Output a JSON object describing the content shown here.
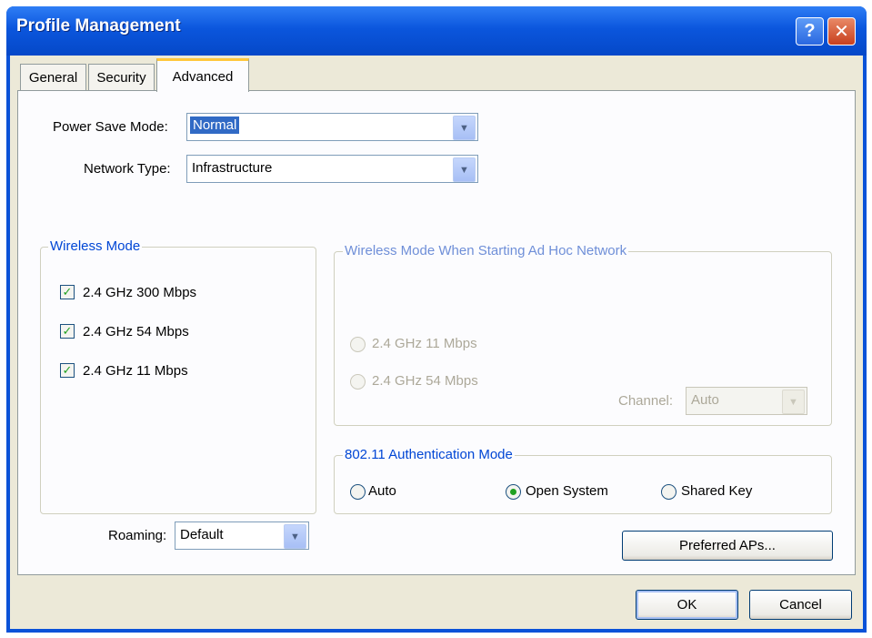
{
  "window": {
    "title": "Profile Management",
    "help_label": "?",
    "close_label": "✕"
  },
  "tabs": [
    {
      "label": "General",
      "active": false
    },
    {
      "label": "Security",
      "active": false
    },
    {
      "label": "Advanced",
      "active": true
    }
  ],
  "power_save": {
    "label": "Power Save Mode:",
    "value": "Normal"
  },
  "network_type": {
    "label": "Network Type:",
    "value": "Infrastructure"
  },
  "wireless_mode": {
    "title": "Wireless Mode",
    "options": [
      {
        "label": "2.4 GHz 300 Mbps",
        "checked": true
      },
      {
        "label": "2.4 GHz 54 Mbps",
        "checked": true
      },
      {
        "label": "2.4 GHz 11 Mbps",
        "checked": true
      }
    ]
  },
  "adhoc_mode": {
    "title": "Wireless Mode When Starting Ad Hoc Network",
    "options": [
      {
        "label": "2.4 GHz 11 Mbps"
      },
      {
        "label": "2.4 GHz 54 Mbps"
      }
    ],
    "channel_label": "Channel:",
    "channel_value": "Auto"
  },
  "auth_mode": {
    "title": "802.11 Authentication Mode",
    "options": [
      {
        "label": "Auto",
        "selected": false
      },
      {
        "label": "Open System",
        "selected": true
      },
      {
        "label": "Shared Key",
        "selected": false
      }
    ]
  },
  "roaming": {
    "label": "Roaming:",
    "value": "Default"
  },
  "buttons": {
    "preferred_aps": "Preferred APs...",
    "ok": "OK",
    "cancel": "Cancel"
  },
  "icons": {
    "check": "check-icon",
    "dropdown": "chevron-down-icon",
    "help": "help-icon",
    "close": "close-icon"
  },
  "colors": {
    "titlebar": "#0b56dd",
    "group_title": "#0046d5",
    "selection": "#316ac5",
    "check": "#21a121"
  }
}
